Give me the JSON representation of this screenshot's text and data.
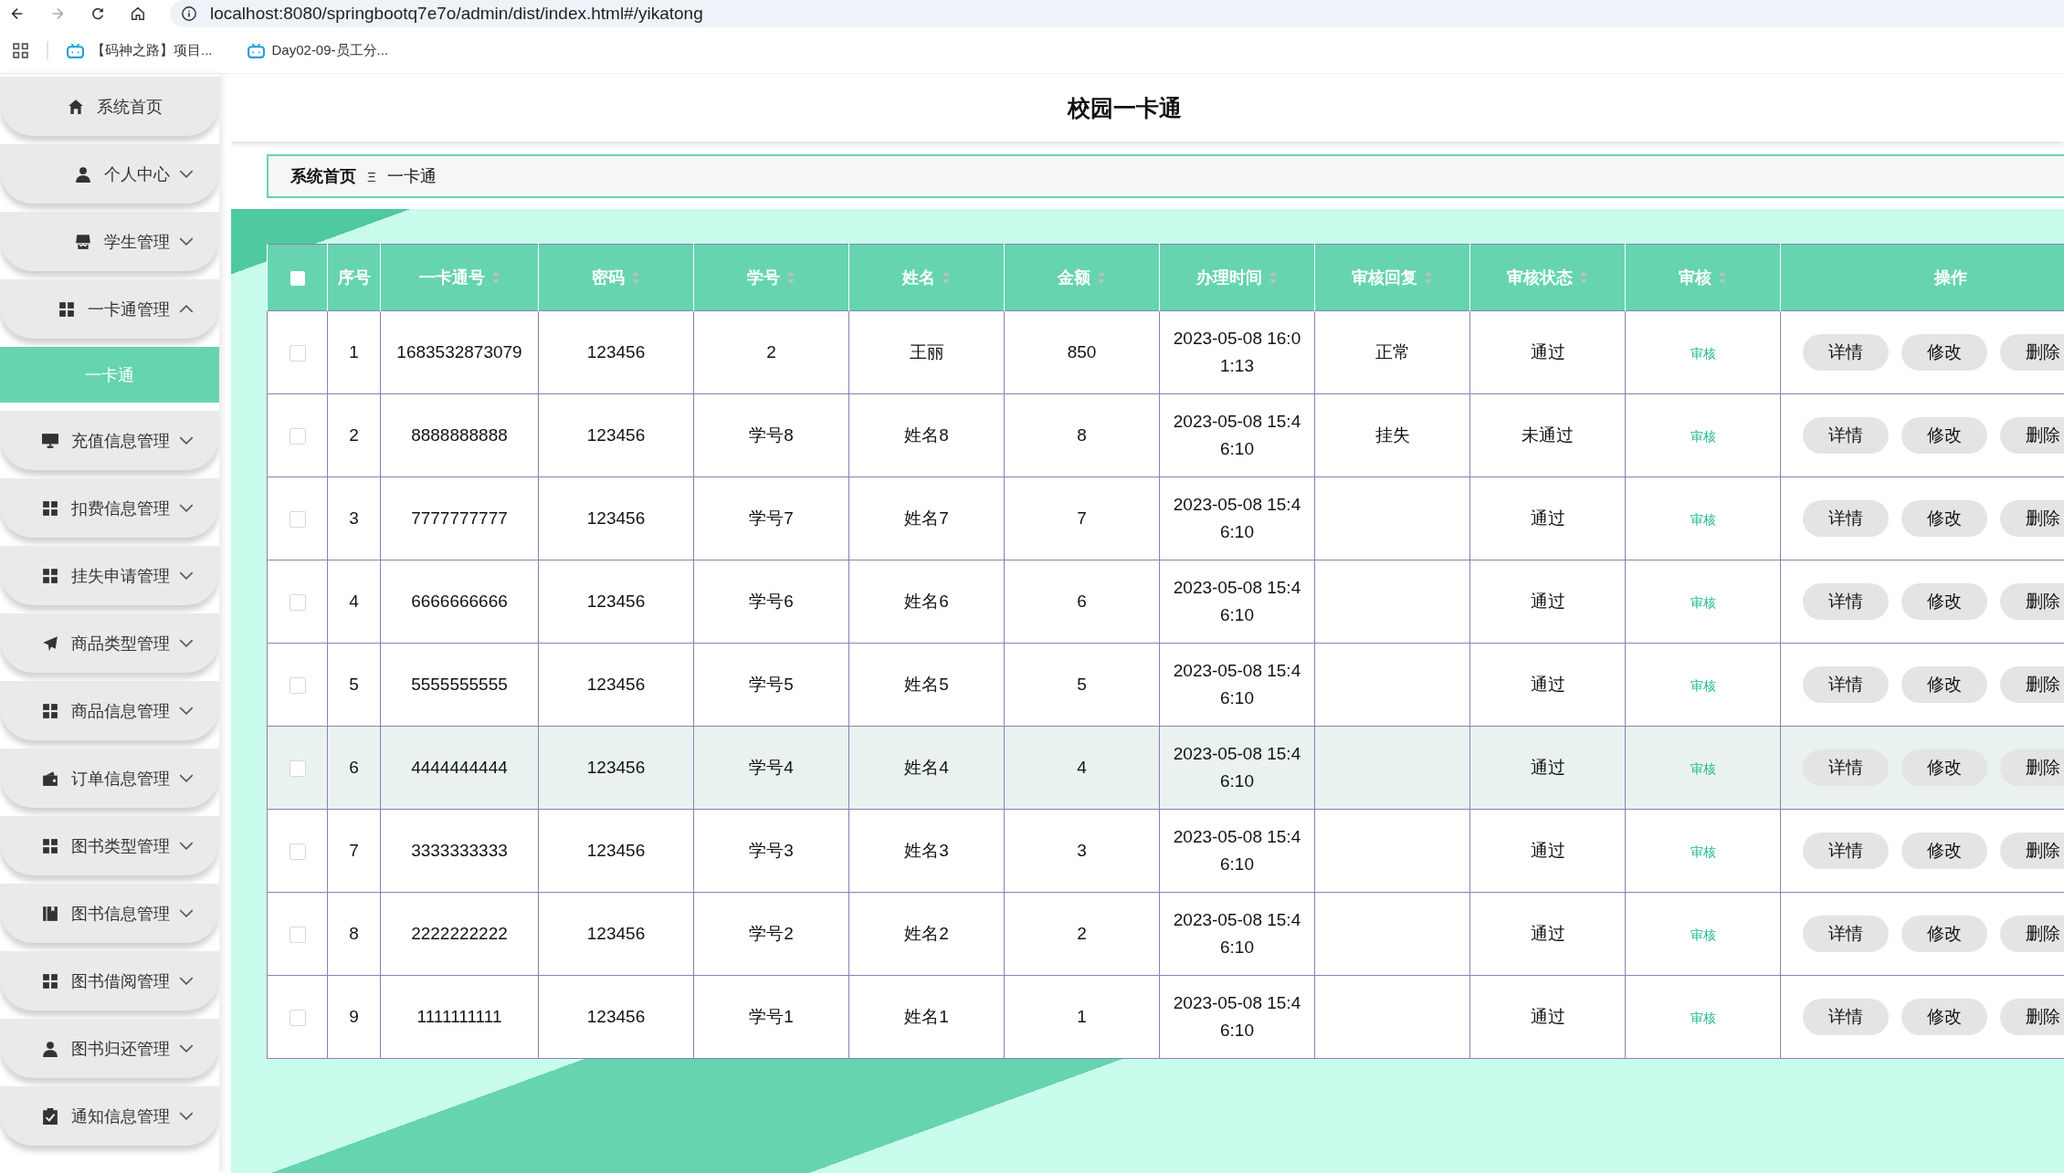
{
  "browser": {
    "url": "localhost:8080/springbootq7e7o/admin/dist/index.html#/yikatong",
    "bookmarks": [
      "【码神之路】项目...",
      "Day02-09-员工分..."
    ]
  },
  "sidebar": {
    "items": [
      {
        "label": "系统首页",
        "kind": "link"
      },
      {
        "label": "个人中心",
        "kind": "menu",
        "expanded": false
      },
      {
        "label": "学生管理",
        "kind": "menu",
        "expanded": false
      },
      {
        "label": "一卡通管理",
        "kind": "menu",
        "expanded": true,
        "children": [
          {
            "label": "一卡通",
            "selected": true
          }
        ]
      },
      {
        "label": "充值信息管理",
        "kind": "menu",
        "expanded": false
      },
      {
        "label": "扣费信息管理",
        "kind": "menu",
        "expanded": false
      },
      {
        "label": "挂失申请管理",
        "kind": "menu",
        "expanded": false
      },
      {
        "label": "商品类型管理",
        "kind": "menu",
        "expanded": false
      },
      {
        "label": "商品信息管理",
        "kind": "menu",
        "expanded": false
      },
      {
        "label": "订单信息管理",
        "kind": "menu",
        "expanded": false
      },
      {
        "label": "图书类型管理",
        "kind": "menu",
        "expanded": false
      },
      {
        "label": "图书信息管理",
        "kind": "menu",
        "expanded": false
      },
      {
        "label": "图书借阅管理",
        "kind": "menu",
        "expanded": false
      },
      {
        "label": "图书归还管理",
        "kind": "menu",
        "expanded": false
      },
      {
        "label": "通知信息管理",
        "kind": "menu",
        "expanded": false
      }
    ]
  },
  "page_title": "校园一卡通",
  "breadcrumb": {
    "home": "系统首页",
    "separator": "Ξ",
    "current": "一卡通"
  },
  "table": {
    "header_checked": false,
    "columns": [
      {
        "label": "序号",
        "sortable": false
      },
      {
        "label": "一卡通号",
        "sortable": true
      },
      {
        "label": "密码",
        "sortable": true
      },
      {
        "label": "学号",
        "sortable": true
      },
      {
        "label": "姓名",
        "sortable": true
      },
      {
        "label": "金额",
        "sortable": true
      },
      {
        "label": "办理时间",
        "sortable": true
      },
      {
        "label": "审核回复",
        "sortable": true
      },
      {
        "label": "审核状态",
        "sortable": true
      },
      {
        "label": "审核",
        "sortable": true
      },
      {
        "label": "操作",
        "sortable": false
      }
    ],
    "rows": [
      {
        "checked": false,
        "highlighted": false,
        "cells": [
          "1",
          "1683532873079",
          "123456",
          "2",
          "王丽",
          "850",
          "2023-05-08 16:01:13",
          "正常",
          "通过"
        ],
        "review": "审核",
        "actions": [
          "详情",
          "修改",
          "删除"
        ]
      },
      {
        "checked": false,
        "highlighted": false,
        "cells": [
          "2",
          "8888888888",
          "123456",
          "学号8",
          "姓名8",
          "8",
          "2023-05-08 15:46:10",
          "挂失",
          "未通过"
        ],
        "review": "审核",
        "actions": [
          "详情",
          "修改",
          "删除"
        ]
      },
      {
        "checked": false,
        "highlighted": false,
        "cells": [
          "3",
          "7777777777",
          "123456",
          "学号7",
          "姓名7",
          "7",
          "2023-05-08 15:46:10",
          "",
          "通过"
        ],
        "review": "审核",
        "actions": [
          "详情",
          "修改",
          "删除"
        ]
      },
      {
        "checked": false,
        "highlighted": false,
        "cells": [
          "4",
          "6666666666",
          "123456",
          "学号6",
          "姓名6",
          "6",
          "2023-05-08 15:46:10",
          "",
          "通过"
        ],
        "review": "审核",
        "actions": [
          "详情",
          "修改",
          "删除"
        ]
      },
      {
        "checked": false,
        "highlighted": false,
        "cells": [
          "5",
          "5555555555",
          "123456",
          "学号5",
          "姓名5",
          "5",
          "2023-05-08 15:46:10",
          "",
          "通过"
        ],
        "review": "审核",
        "actions": [
          "详情",
          "修改",
          "删除"
        ]
      },
      {
        "checked": false,
        "highlighted": true,
        "cells": [
          "6",
          "4444444444",
          "123456",
          "学号4",
          "姓名4",
          "4",
          "2023-05-08 15:46:10",
          "",
          "通过"
        ],
        "review": "审核",
        "actions": [
          "详情",
          "修改",
          "删除"
        ]
      },
      {
        "checked": false,
        "highlighted": false,
        "cells": [
          "7",
          "3333333333",
          "123456",
          "学号3",
          "姓名3",
          "3",
          "2023-05-08 15:46:10",
          "",
          "通过"
        ],
        "review": "审核",
        "actions": [
          "详情",
          "修改",
          "删除"
        ]
      },
      {
        "checked": false,
        "highlighted": false,
        "cells": [
          "8",
          "2222222222",
          "123456",
          "学号2",
          "姓名2",
          "2",
          "2023-05-08 15:46:10",
          "",
          "通过"
        ],
        "review": "审核",
        "actions": [
          "详情",
          "修改",
          "删除"
        ]
      },
      {
        "checked": false,
        "highlighted": false,
        "cells": [
          "9",
          "1111111111",
          "123456",
          "学号1",
          "姓名1",
          "1",
          "2023-05-08 15:46:10",
          "",
          "通过"
        ],
        "review": "审核",
        "actions": [
          "详情",
          "修改",
          "删除"
        ]
      }
    ]
  }
}
